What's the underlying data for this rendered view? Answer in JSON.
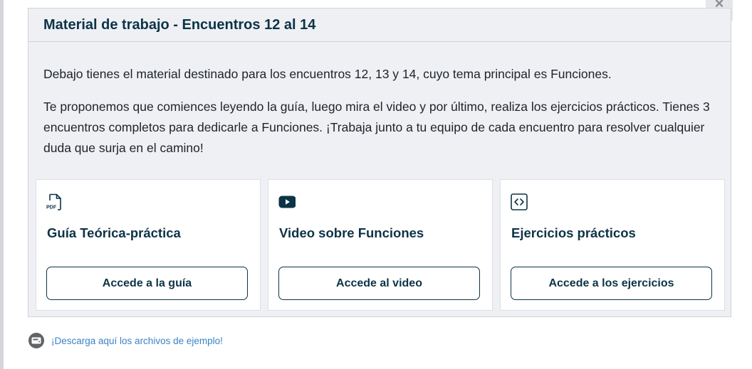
{
  "close": {
    "glyph": "×"
  },
  "panel": {
    "title": "Material de trabajo - Encuentros 12 al 14",
    "paragraphs": [
      "Debajo tienes el material destinado para los encuentros 12, 13 y 14, cuyo tema principal es Funciones.",
      "Te proponemos que comiences leyendo la guía, luego mira el video y por último, realiza los ejercicios prácticos. Tienes 3 encuentros completos para dedicarle a Funciones. ¡Trabaja junto a tu equipo de cada encuentro para resolver cualquier duda que surja en el camino!"
    ]
  },
  "cards": [
    {
      "icon": "pdf-file-icon",
      "icon_text": "PDF",
      "title": "Guía Teórica-práctica",
      "button": "Accede a la guía"
    },
    {
      "icon": "youtube-play-icon",
      "title": "Video sobre Funciones",
      "button": "Accede al video"
    },
    {
      "icon": "code-brackets-icon",
      "title": "Ejercicios prácticos",
      "button": "Accede a los ejercicios"
    }
  ],
  "download": {
    "icon": "hard-drive-icon",
    "label": "¡Descarga aquí los archivos de ejemplo!"
  },
  "colors": {
    "title_navy": "#0d3347",
    "panel_bg": "#eef0f4",
    "link_blue": "#3b83c4"
  }
}
